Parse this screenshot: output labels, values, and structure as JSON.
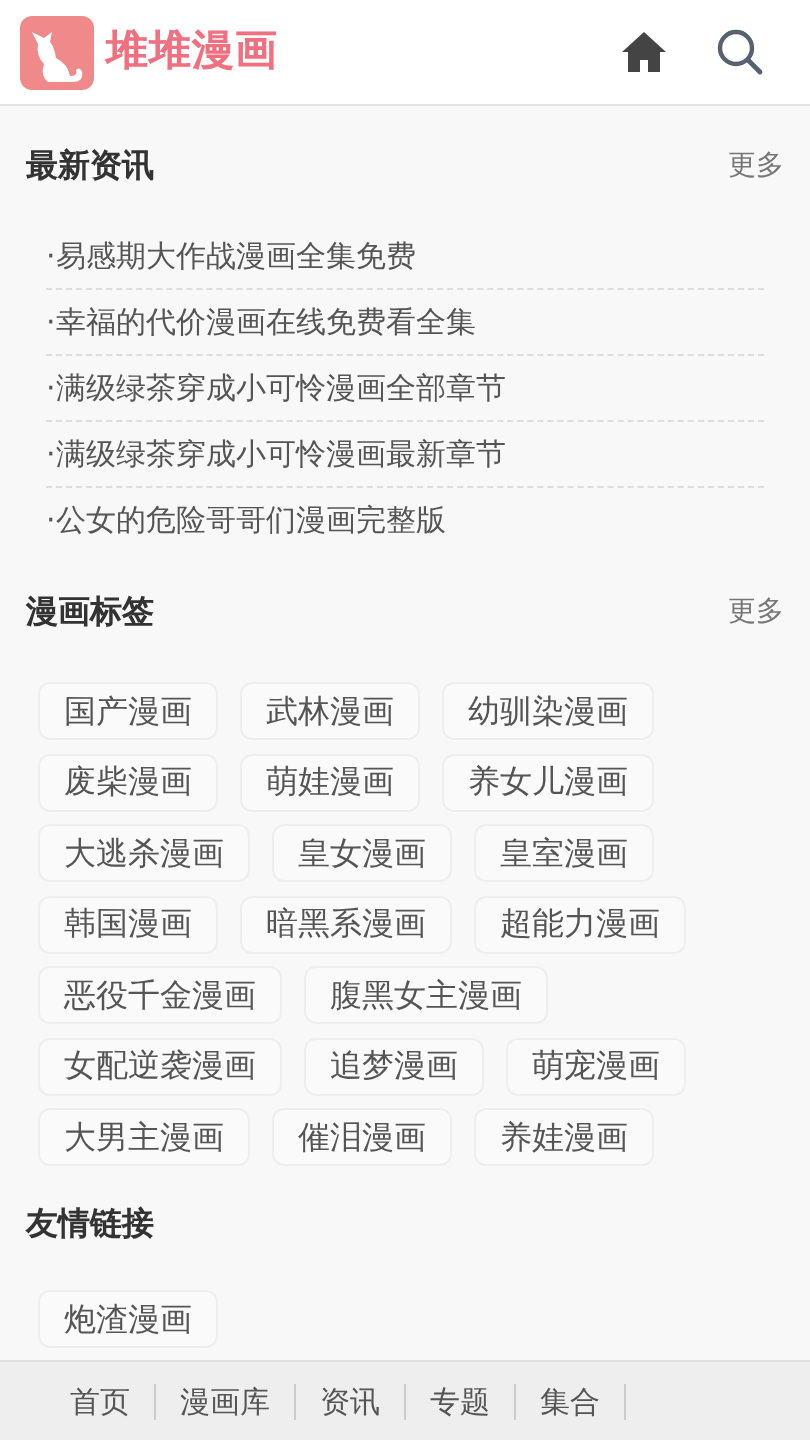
{
  "header": {
    "site_name": "堆堆漫画"
  },
  "news": {
    "title": "最新资讯",
    "more": "更多",
    "items": [
      "·易感期大作战漫画全集免费",
      "·幸福的代价漫画在线免费看全集",
      "·满级绿茶穿成小可怜漫画全部章节",
      "·满级绿茶穿成小可怜漫画最新章节",
      "·公女的危险哥哥们漫画完整版"
    ]
  },
  "tags": {
    "title": "漫画标签",
    "more": "更多",
    "items": [
      "国产漫画",
      "武林漫画",
      "幼驯染漫画",
      "废柴漫画",
      "萌娃漫画",
      "养女儿漫画",
      "大逃杀漫画",
      "皇女漫画",
      "皇室漫画",
      "韩国漫画",
      "暗黑系漫画",
      "超能力漫画",
      "恶役千金漫画",
      "腹黑女主漫画",
      "女配逆袭漫画",
      "追梦漫画",
      "萌宠漫画",
      "大男主漫画",
      "催泪漫画",
      "养娃漫画"
    ]
  },
  "links": {
    "title": "友情链接",
    "items": [
      "炮渣漫画"
    ]
  },
  "footer": {
    "links": [
      "首页",
      "漫画库",
      "资讯",
      "专题",
      "集合"
    ]
  }
}
